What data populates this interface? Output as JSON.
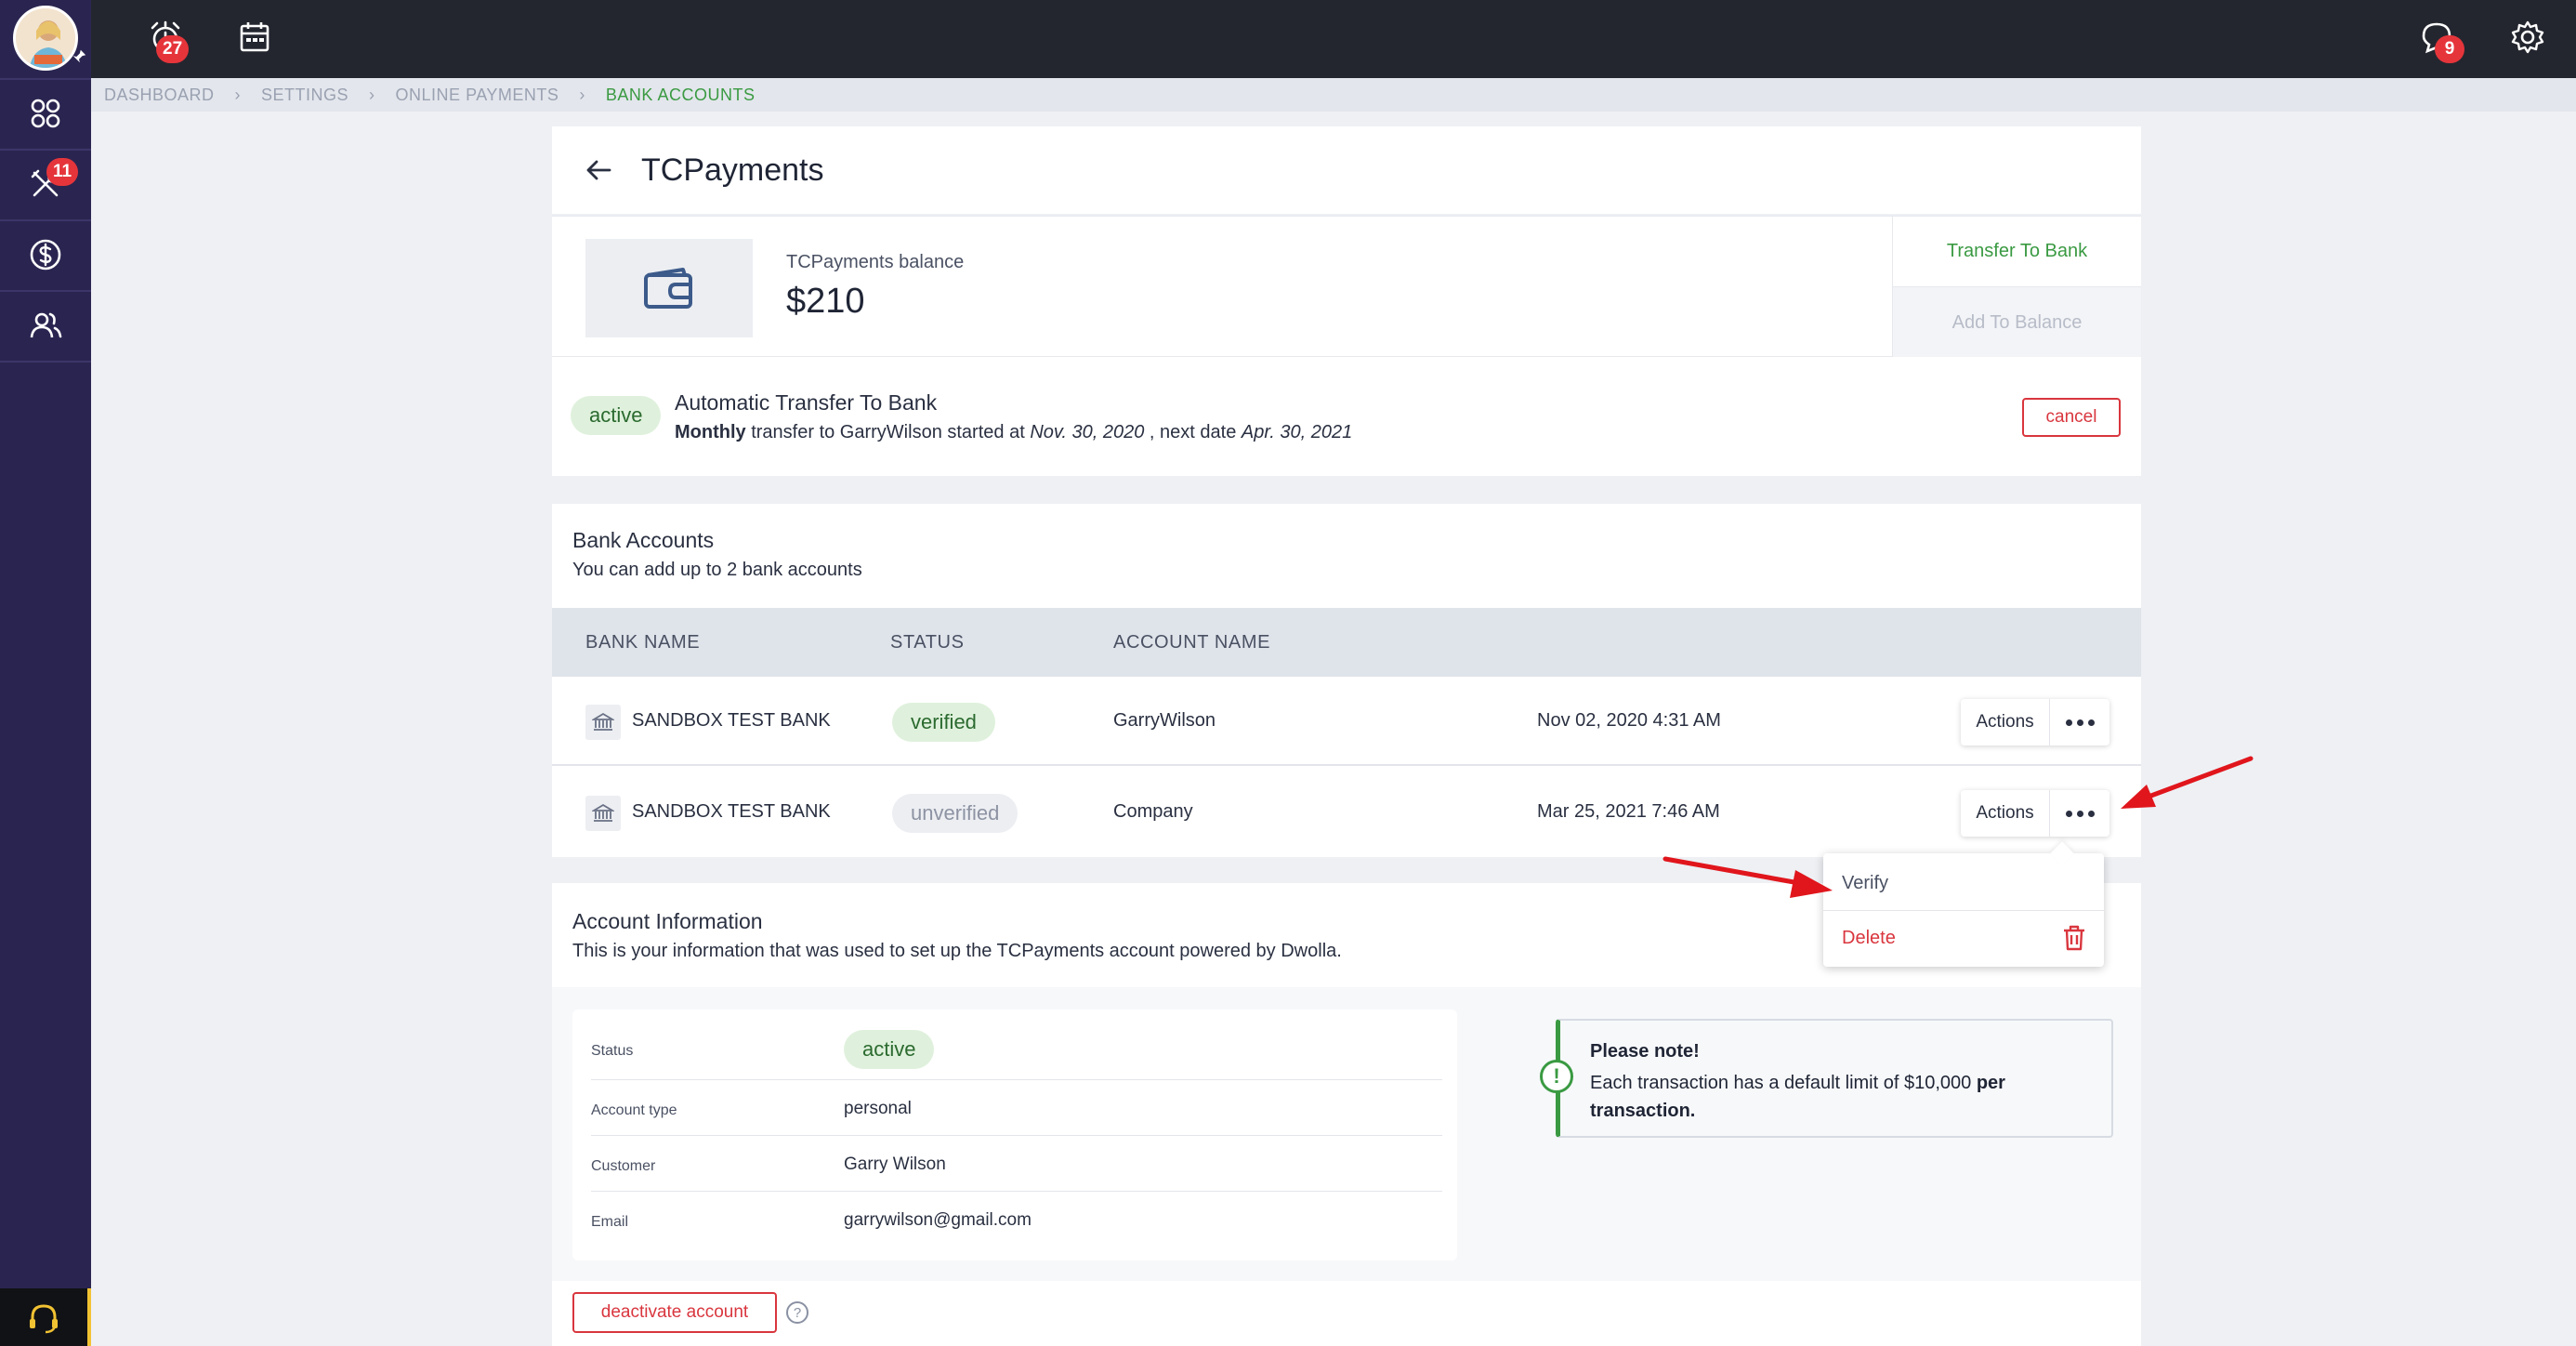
{
  "topbar": {
    "alarm_badge": "27",
    "chat_badge": "9"
  },
  "sidebar": {
    "tools_badge": "11"
  },
  "breadcrumb": [
    "DASHBOARD",
    "SETTINGS",
    "ONLINE PAYMENTS",
    "BANK ACCOUNTS"
  ],
  "page": {
    "title": "TCPayments"
  },
  "balance": {
    "label": "TCPayments balance",
    "value": "$210",
    "transfer_label": "Transfer To Bank",
    "add_label": "Add To Balance"
  },
  "auto_transfer": {
    "status": "active",
    "title": "Automatic Transfer To Bank",
    "frequency": "Monthly",
    "text_1": " transfer to GarryWilson started at ",
    "start_date": "Nov. 30, 2020",
    "text_2": " , next date ",
    "next_date": "Apr. 30, 2021",
    "cancel_label": "cancel"
  },
  "bank_accounts": {
    "title": "Bank Accounts",
    "subtitle": "You can add up to 2 bank accounts",
    "columns": [
      "BANK NAME",
      "STATUS",
      "ACCOUNT NAME"
    ],
    "rows": [
      {
        "bank": "SANDBOX TEST BANK",
        "status": "verified",
        "account": "GarryWilson",
        "date": "Nov 02, 2020 4:31 AM",
        "actions": "Actions"
      },
      {
        "bank": "SANDBOX TEST BANK",
        "status": "unverified",
        "account": "Company",
        "date": "Mar 25, 2021 7:46 AM",
        "actions": "Actions"
      }
    ]
  },
  "dropdown": {
    "verify": "Verify",
    "delete": "Delete"
  },
  "account_info": {
    "title": "Account Information",
    "subtitle": "This is your information that was used to set up the TCPayments account powered by Dwolla.",
    "fields": [
      {
        "key": "Status",
        "value": "active"
      },
      {
        "key": "Account type",
        "value": "personal"
      },
      {
        "key": "Customer",
        "value": "Garry Wilson"
      },
      {
        "key": "Email",
        "value": "garrywilson@gmail.com"
      }
    ],
    "note_title": "Please note!",
    "note_text": "Each transaction has a default limit of $10,000 ",
    "note_bold": "per transaction.",
    "deactivate_label": "deactivate account",
    "help": "?"
  },
  "colors": {
    "accent_green": "#3a9a42",
    "danger_red": "#d9363e",
    "sidebar": "#2a2550",
    "arrow": "#e0161c"
  }
}
